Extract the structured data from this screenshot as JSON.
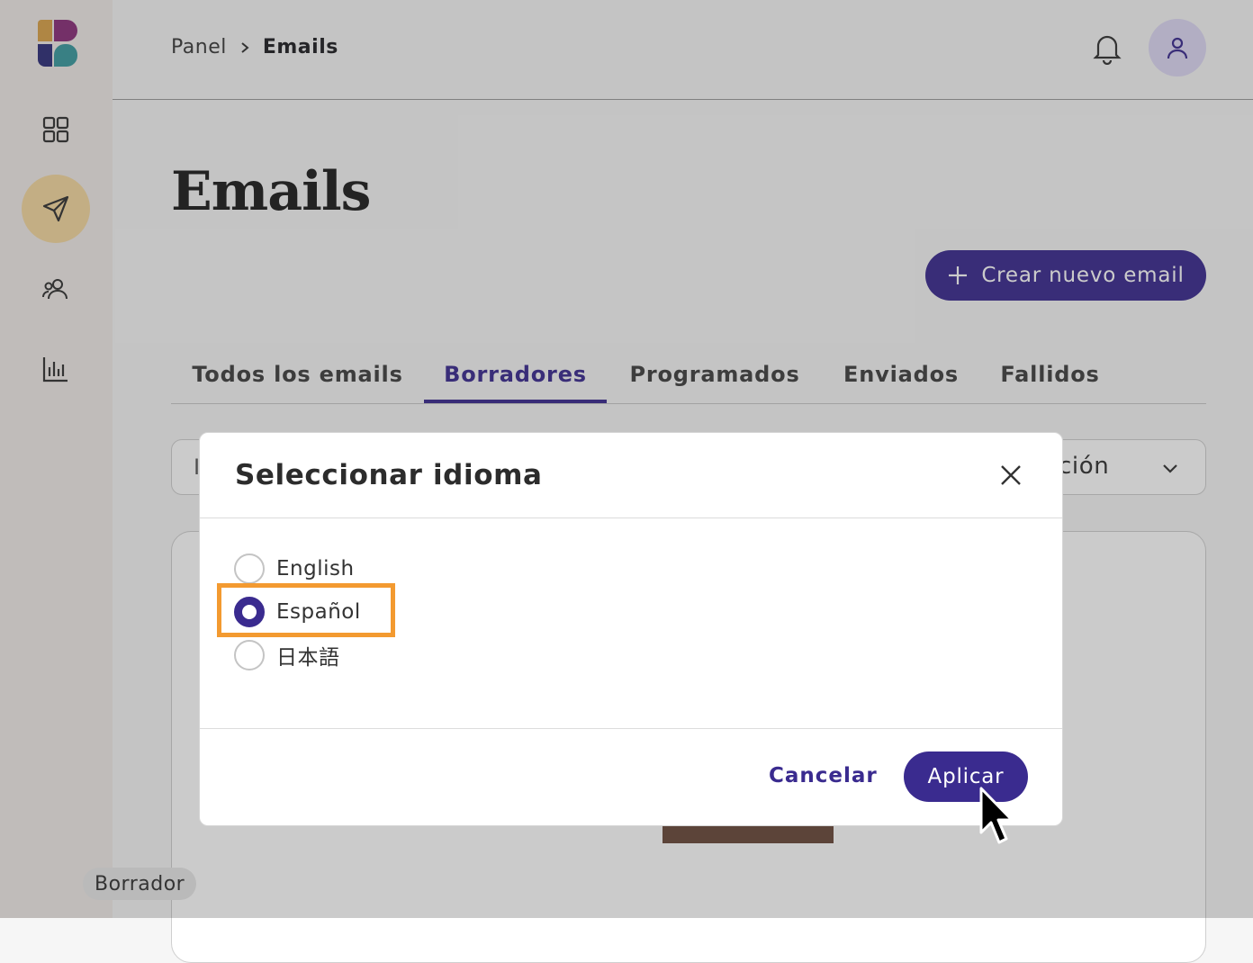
{
  "breadcrumb": {
    "parent": "Panel",
    "current": "Emails"
  },
  "page": {
    "title": "Emails"
  },
  "actions": {
    "create_label": "Crear nuevo email"
  },
  "tabs": [
    {
      "label": "Todos los emails",
      "active": false
    },
    {
      "label": "Borradores",
      "active": true
    },
    {
      "label": "Programados",
      "active": false
    },
    {
      "label": "Enviados",
      "active": false
    },
    {
      "label": "Fallidos",
      "active": false
    }
  ],
  "filter": {
    "left_partial": "I",
    "right_partial": "ción"
  },
  "card": {
    "status_badge": "Borrador"
  },
  "modal": {
    "title": "Seleccionar idioma",
    "options": [
      {
        "label": "English",
        "selected": false
      },
      {
        "label": "Español",
        "selected": true
      },
      {
        "label": "日本語",
        "selected": false
      }
    ],
    "cancel_label": "Cancelar",
    "apply_label": "Aplicar"
  },
  "colors": {
    "primary": "#3a2b8f",
    "active_nav": "#f4d8a0",
    "highlight": "#f39a30"
  },
  "icons": [
    "logo",
    "dashboard-icon",
    "send-icon",
    "users-icon",
    "chart-icon",
    "bell-icon",
    "user-icon",
    "plus-icon",
    "chevron-right-icon",
    "chevron-down-icon",
    "close-icon",
    "cursor-icon"
  ]
}
